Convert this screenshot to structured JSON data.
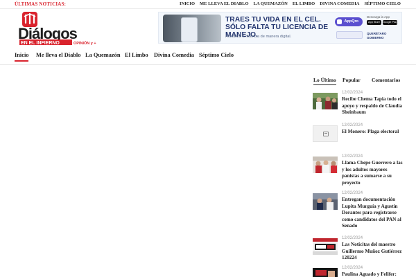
{
  "ticker": {
    "label": "ÚLTIMAS NOTICIAS:"
  },
  "top_nav": [
    "INICIO",
    "ME LLEVA EL DIABLO",
    "LA QUEMAZÓN",
    "EL LIMBO",
    "DIVINA COMEDIA",
    "SÉPTIMO CIELO"
  ],
  "logo": {
    "line1": "Diálogos",
    "line2": "EN EL INFIERNO",
    "tagline": "OPINIÓN y +"
  },
  "ad_banner": {
    "headline": "TRAES TU VIDA EN EL CEL. SÓLO FALTA TU LICENCIA DE MANEJO.",
    "subtext": "Actualiza tu licencia de manera digital.",
    "app_name": "AppQro",
    "download_label": "Descarga la App",
    "store_badges": [
      "App Store",
      "Google Play"
    ],
    "gov_label": "QUERÉTARO GOBIERNO"
  },
  "main_nav": [
    "Inicio",
    "Me lleva el Diablo",
    "La Quemazón",
    "El Limbo",
    "Divina Comedia",
    "Séptimo Cielo"
  ],
  "sidebar": {
    "tabs": [
      "Lo Último",
      "Popular",
      "Comentarios"
    ],
    "posts": [
      {
        "date": "12/02/2024",
        "title": "Recibe Chema Tapia todo el apoyo y respaldo de Claudia Sheinbaum"
      },
      {
        "date": "12/02/2024",
        "title": "El Monero: Plaga electoral"
      },
      {
        "date": "12/02/2024",
        "title": "Llama Chepe Guerrero a las y los adultos mayores panistas a sumarse a su proyecto"
      },
      {
        "date": "12/02/2024",
        "title": "Entregan documentación Lupita Murguía y Agustín Dorantes para registrarse como candidatos del PAN al Senado"
      },
      {
        "date": "12/02/2024",
        "title": "Las Noticitas del maestro Guillermo Muñoz Gutiérrez 120224"
      },
      {
        "date": "12/02/2024",
        "title": "Paulina Aguado y Felifer:"
      }
    ]
  },
  "colors": {
    "accent": "#d9232d",
    "navy": "#23356f",
    "text": "#222222"
  }
}
